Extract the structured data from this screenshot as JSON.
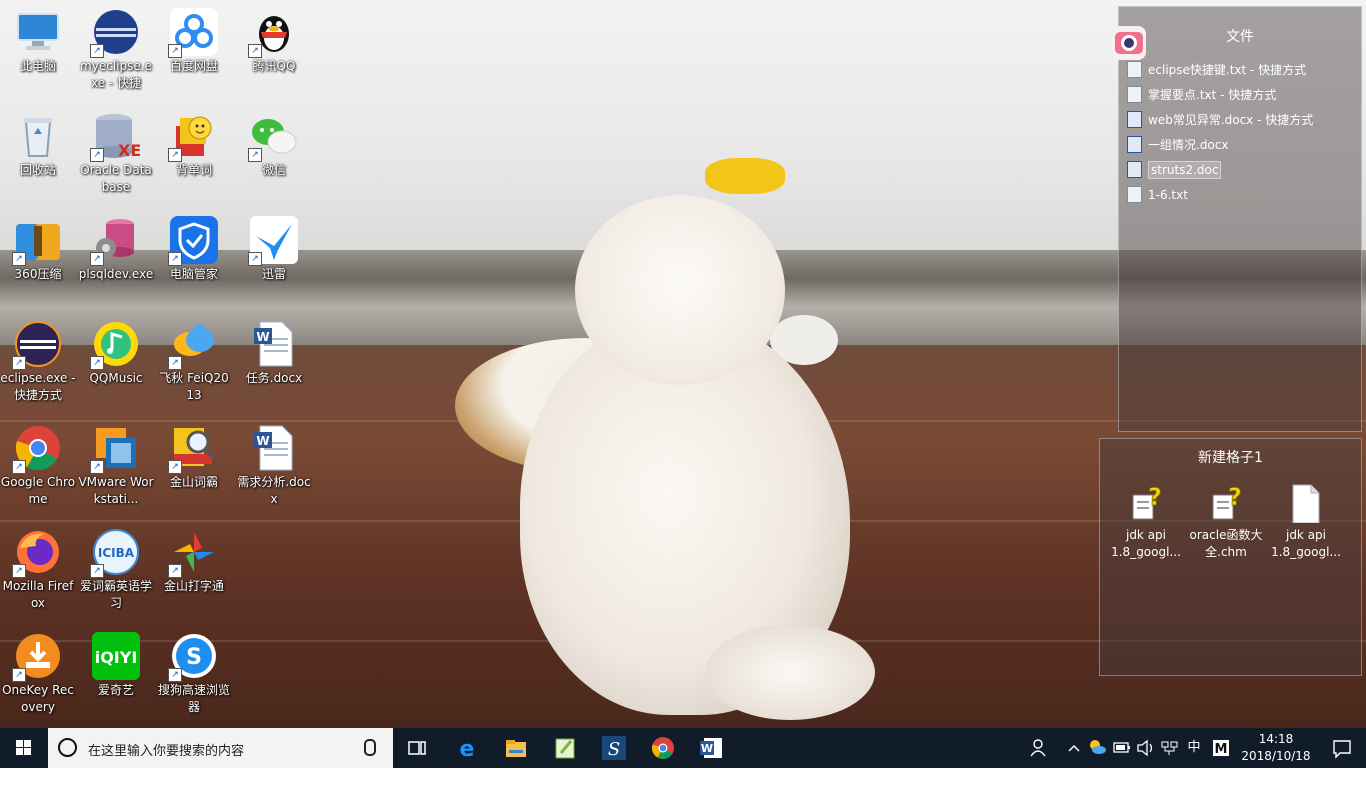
{
  "desktop": {
    "icons": [
      {
        "label": "此电脑",
        "icon": "this-pc-icon"
      },
      {
        "label": "myeclipse.exe - 快捷",
        "icon": "myeclipse-icon"
      },
      {
        "label": "百度网盘",
        "icon": "baidu-netdisk-icon"
      },
      {
        "label": "腾讯QQ",
        "icon": "qq-penguin-icon"
      },
      {
        "label": "回收站",
        "icon": "recycle-bin-icon"
      },
      {
        "label": "Oracle Database",
        "icon": "oracle-database-icon"
      },
      {
        "label": "背单词",
        "icon": "vocabulary-book-icon"
      },
      {
        "label": "微信",
        "icon": "wechat-icon"
      },
      {
        "label": "360压缩",
        "icon": "zip-archive-icon"
      },
      {
        "label": "plsqldev.exe",
        "icon": "plsql-developer-icon"
      },
      {
        "label": "电脑管家",
        "icon": "pc-manager-shield-icon"
      },
      {
        "label": "迅雷",
        "icon": "thunder-bird-icon"
      },
      {
        "label": "eclipse.exe - 快捷方式",
        "icon": "eclipse-icon"
      },
      {
        "label": "QQMusic",
        "icon": "qq-music-icon"
      },
      {
        "label": "飞秋 FeiQ2013",
        "icon": "feiq-icon"
      },
      {
        "label": "任务.docx",
        "icon": "word-document-icon"
      },
      {
        "label": "Google Chrome",
        "icon": "chrome-icon"
      },
      {
        "label": "VMware Workstati...",
        "icon": "vmware-icon"
      },
      {
        "label": "金山词霸",
        "icon": "kingsoft-dict-icon"
      },
      {
        "label": "需求分析.docx",
        "icon": "word-document-icon"
      },
      {
        "label": "Mozilla Firefox",
        "icon": "firefox-icon"
      },
      {
        "label": "爱词霸英语学习",
        "icon": "iciba-icon"
      },
      {
        "label": "金山打字通",
        "icon": "kingsoft-typing-icon"
      },
      {
        "label": "OneKey Recovery",
        "icon": "onekey-recovery-icon"
      },
      {
        "label": "爱奇艺",
        "icon": "iqiyi-icon"
      },
      {
        "label": "搜狗高速浏览器",
        "icon": "sogou-browser-icon"
      }
    ]
  },
  "fence_files": {
    "title": "文件",
    "items": [
      {
        "label": "eclipse快捷键.txt - 快捷方式",
        "kind": "txt"
      },
      {
        "label": "掌握要点.txt - 快捷方式",
        "kind": "txt"
      },
      {
        "label": "web常见异常.docx - 快捷方式",
        "kind": "word"
      },
      {
        "label": "一组情况.docx",
        "kind": "word"
      },
      {
        "label": "struts2.doc",
        "kind": "word"
      },
      {
        "label": "1-6.txt",
        "kind": "txt"
      }
    ]
  },
  "fence_grid": {
    "title": "新建格子1",
    "items": [
      {
        "label": "jdk api 1.8_googl...",
        "icon": "chm-help-icon"
      },
      {
        "label": "oracle函数大全.chm",
        "icon": "chm-help-icon"
      },
      {
        "label": "jdk api 1.8_googl...",
        "icon": "blank-file-icon"
      }
    ]
  },
  "taskbar": {
    "search_placeholder": "在这里输入你要搜索的内容",
    "ime": "中",
    "clock_time": "14:18",
    "clock_date": "2018/10/18"
  }
}
